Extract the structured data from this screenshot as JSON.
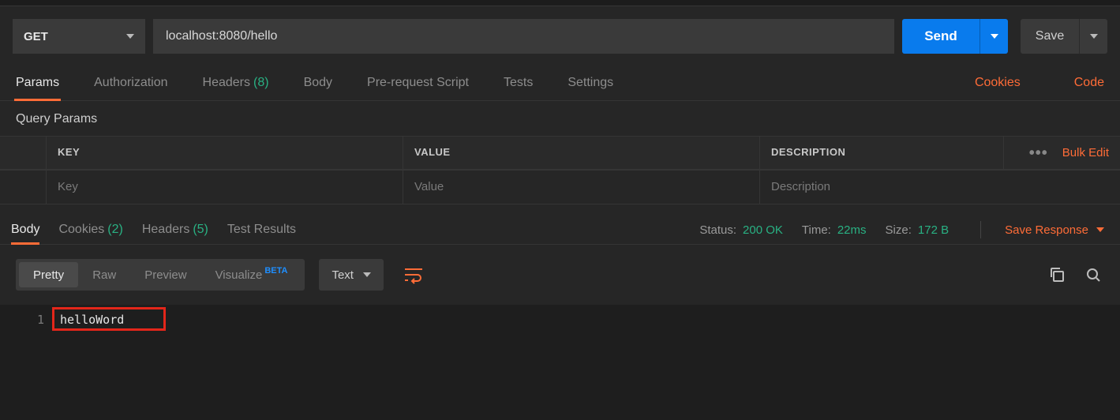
{
  "request": {
    "method": "GET",
    "url": "localhost:8080/hello",
    "send": "Send",
    "save": "Save"
  },
  "tabs": {
    "params": "Params",
    "auth": "Authorization",
    "headers": "Headers",
    "headers_count": "(8)",
    "body": "Body",
    "prereq": "Pre-request Script",
    "tests": "Tests",
    "settings": "Settings",
    "cookies": "Cookies",
    "code": "Code"
  },
  "query": {
    "title": "Query Params",
    "thead": {
      "key": "KEY",
      "value": "VALUE",
      "desc": "DESCRIPTION",
      "bulk": "Bulk Edit",
      "dots": "•••"
    },
    "placeholders": {
      "key": "Key",
      "value": "Value",
      "desc": "Description"
    }
  },
  "response": {
    "tabs": {
      "body": "Body",
      "cookies": "Cookies",
      "cookies_count": "(2)",
      "headers": "Headers",
      "headers_count": "(5)",
      "tests": "Test Results"
    },
    "status_label": "Status:",
    "status": "200 OK",
    "time_label": "Time:",
    "time": "22ms",
    "size_label": "Size:",
    "size": "172 B",
    "save": "Save Response"
  },
  "viewer": {
    "pretty": "Pretty",
    "raw": "Raw",
    "preview": "Preview",
    "visualize": "Visualize",
    "beta": "BETA",
    "format": "Text"
  },
  "code": {
    "line1_num": "1",
    "line1_text": "helloWord"
  }
}
